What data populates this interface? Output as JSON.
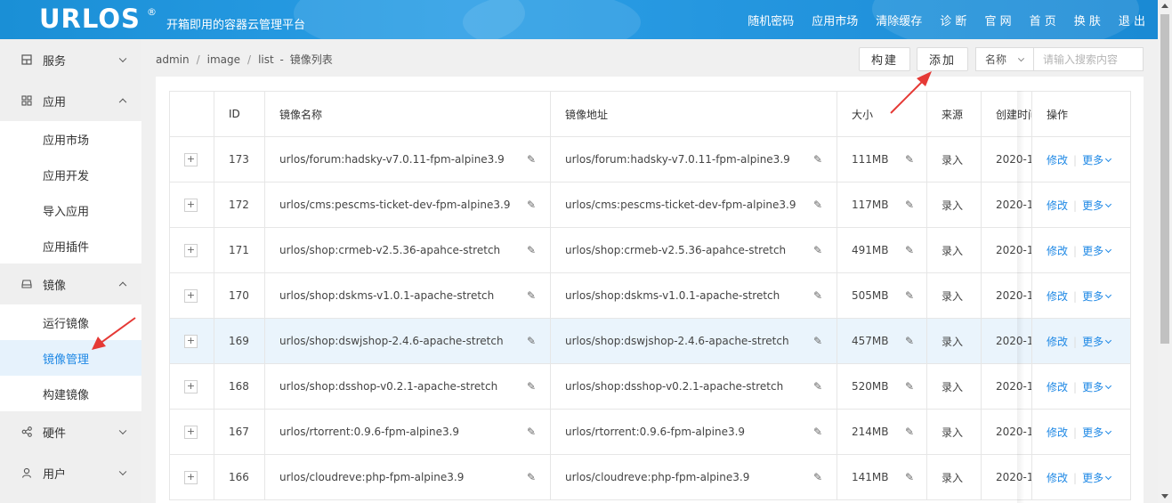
{
  "header": {
    "logo": "URLOS",
    "logo_mark": "®",
    "tagline": "开箱即用的容器云管理平台",
    "nav": [
      "随机密码",
      "应用市场",
      "清除缓存",
      "诊 断",
      "官 网",
      "首 页",
      "换 肤",
      "退 出"
    ]
  },
  "sidebar": {
    "groups": [
      {
        "label": "服务",
        "icon": "grid-icon",
        "expanded": false
      },
      {
        "label": "应用",
        "icon": "apps-icon",
        "expanded": true,
        "items": [
          "应用市场",
          "应用开发",
          "导入应用",
          "应用插件"
        ]
      },
      {
        "label": "镜像",
        "icon": "drive-icon",
        "expanded": true,
        "items": [
          "运行镜像",
          "镜像管理",
          "构建镜像"
        ],
        "active": "镜像管理"
      },
      {
        "label": "硬件",
        "icon": "share-icon",
        "expanded": false
      },
      {
        "label": "用户",
        "icon": "user-icon",
        "expanded": false
      }
    ]
  },
  "breadcrumb": {
    "items": [
      "admin",
      "image",
      "list"
    ],
    "current": "镜像列表",
    "sep": "/",
    "dash": "-"
  },
  "toolbar": {
    "build_label": "构建",
    "add_label": "添加",
    "search_field": "名称",
    "search_placeholder": "请输入搜索内容"
  },
  "table": {
    "columns": [
      "ID",
      "镜像名称",
      "镜像地址",
      "大小",
      "来源",
      "创建时间",
      "操作"
    ],
    "rows": [
      {
        "id": "173",
        "name": "urlos/forum:hadsky-v7.0.11-fpm-alpine3.9",
        "address": "urlos/forum:hadsky-v7.0.11-fpm-alpine3.9",
        "size": "111MB",
        "source": "录入",
        "created": "2020-1"
      },
      {
        "id": "172",
        "name": "urlos/cms:pescms-ticket-dev-fpm-alpine3.9",
        "address": "urlos/cms:pescms-ticket-dev-fpm-alpine3.9",
        "size": "117MB",
        "source": "录入",
        "created": "2020-1"
      },
      {
        "id": "171",
        "name": "urlos/shop:crmeb-v2.5.36-apahce-stretch",
        "address": "urlos/shop:crmeb-v2.5.36-apahce-stretch",
        "size": "491MB",
        "source": "录入",
        "created": "2020-1"
      },
      {
        "id": "170",
        "name": "urlos/shop:dskms-v1.0.1-apache-stretch",
        "address": "urlos/shop:dskms-v1.0.1-apache-stretch",
        "size": "505MB",
        "source": "录入",
        "created": "2020-1"
      },
      {
        "id": "169",
        "name": "urlos/shop:dswjshop-2.4.6-apache-stretch",
        "address": "urlos/shop:dswjshop-2.4.6-apache-stretch",
        "size": "457MB",
        "source": "录入",
        "created": "2020-1",
        "highlighted": true
      },
      {
        "id": "168",
        "name": "urlos/shop:dsshop-v0.2.1-apache-stretch",
        "address": "urlos/shop:dsshop-v0.2.1-apache-stretch",
        "size": "520MB",
        "source": "录入",
        "created": "2020-1"
      },
      {
        "id": "167",
        "name": "urlos/rtorrent:0.9.6-fpm-alpine3.9",
        "address": "urlos/rtorrent:0.9.6-fpm-alpine3.9",
        "size": "214MB",
        "source": "录入",
        "created": "2020-1"
      },
      {
        "id": "166",
        "name": "urlos/cloudreve:php-fpm-alpine3.9",
        "address": "urlos/cloudreve:php-fpm-alpine3.9",
        "size": "141MB",
        "source": "录入",
        "created": "2020-1"
      }
    ],
    "expand_symbol": "+",
    "edit_label": "修改",
    "more_label": "更多",
    "op_sep": "|"
  },
  "colors": {
    "header_blue": "#1e90d8",
    "link_blue": "#1e88e5",
    "active_bg": "#e6f2fc",
    "highlight_row": "#eaf4fc",
    "arrow_red": "#e53935"
  }
}
